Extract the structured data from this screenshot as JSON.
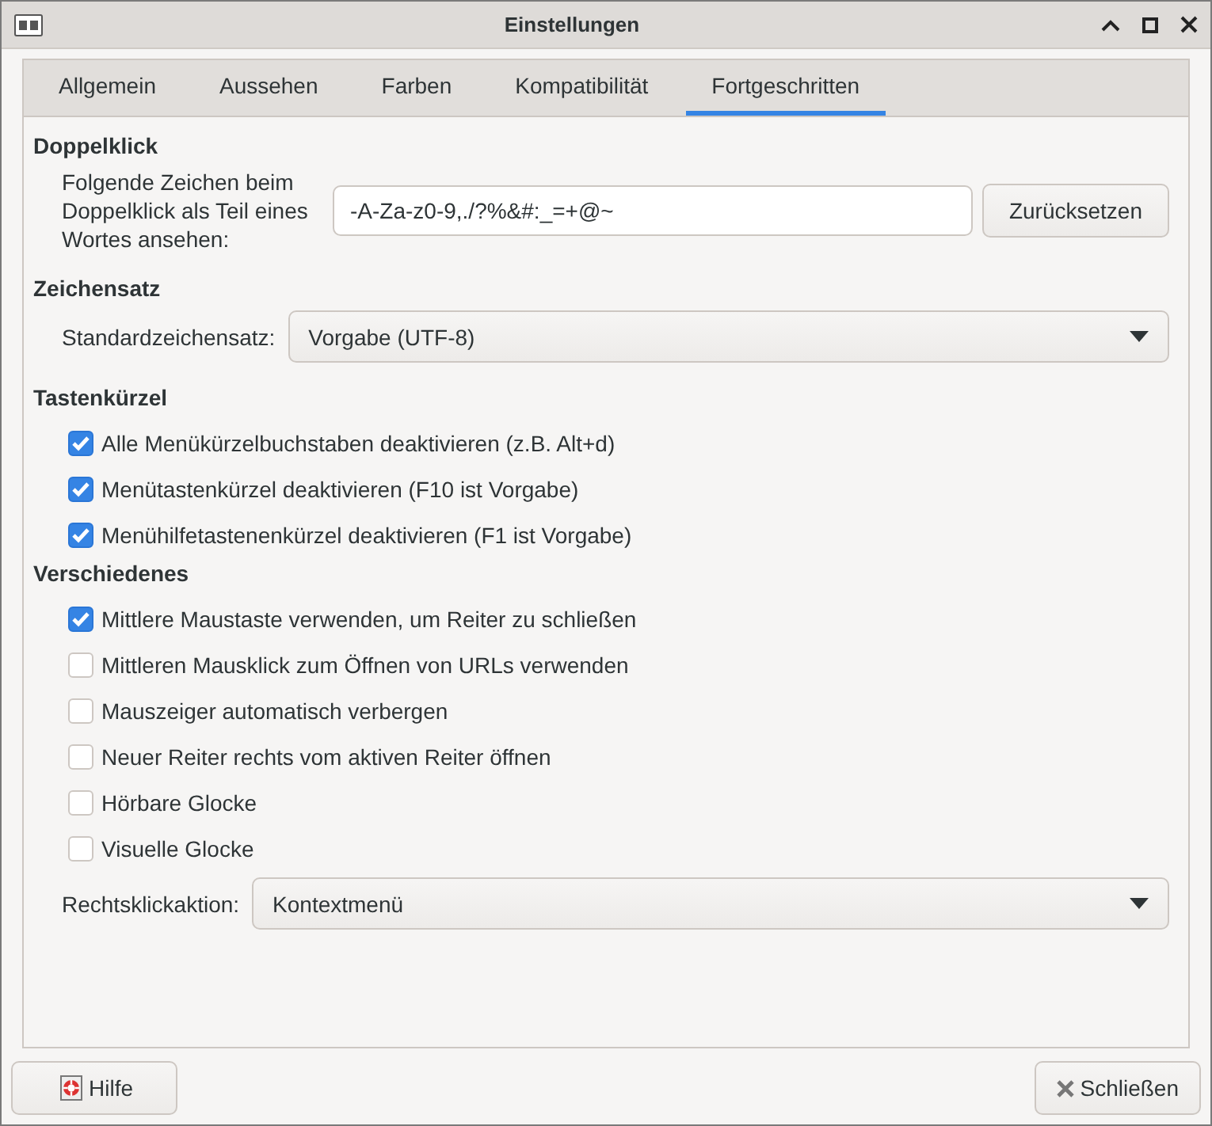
{
  "window": {
    "title": "Einstellungen"
  },
  "tabs": [
    {
      "label": "Allgemein",
      "selected": false
    },
    {
      "label": "Aussehen",
      "selected": false
    },
    {
      "label": "Farben",
      "selected": false
    },
    {
      "label": "Kompatibilität",
      "selected": false
    },
    {
      "label": "Fortgeschritten",
      "selected": true
    }
  ],
  "double_click": {
    "heading": "Doppelklick",
    "label": "Folgende Zeichen beim Doppelklick als Teil eines Wortes ansehen:",
    "value": "-A-Za-z0-9,./?%&#:_=+@~",
    "reset_button": "Zurücksetzen"
  },
  "charset": {
    "heading": "Zeichensatz",
    "label": "Standardzeichensatz:",
    "value": "Vorgabe (UTF-8)"
  },
  "shortcuts": {
    "heading": "Tastenkürzel",
    "options": [
      {
        "label": "Alle Menükürzelbuchstaben deaktivieren (z.B. Alt+d)",
        "checked": true
      },
      {
        "label": "Menütastenkürzel deaktivieren (F10 ist Vorgabe)",
        "checked": true
      },
      {
        "label": "Menühilfetastenenkürzel deaktivieren (F1 ist Vorgabe)",
        "checked": true
      }
    ]
  },
  "misc": {
    "heading": "Verschiedenes",
    "options": [
      {
        "label": "Mittlere Maustaste verwenden, um Reiter zu schließen",
        "checked": true
      },
      {
        "label": "Mittleren Mausklick zum Öffnen von URLs verwenden",
        "checked": false
      },
      {
        "label": "Mauszeiger automatisch verbergen",
        "checked": false
      },
      {
        "label": "Neuer Reiter rechts vom aktiven Reiter öffnen",
        "checked": false
      },
      {
        "label": "Hörbare Glocke",
        "checked": false
      },
      {
        "label": "Visuelle Glocke",
        "checked": false
      }
    ],
    "right_click_label": "Rechtsklickaktion:",
    "right_click_value": "Kontextmenü"
  },
  "buttons": {
    "help": "Hilfe",
    "close": "Schließen"
  }
}
